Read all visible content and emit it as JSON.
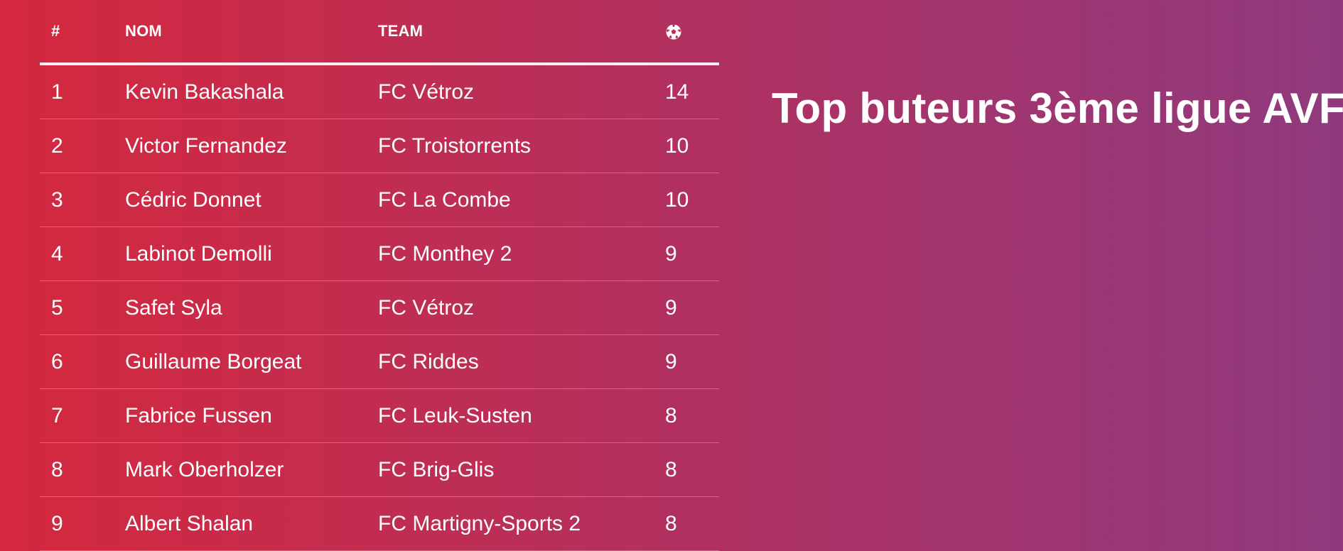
{
  "title": "Top buteurs 3ème ligue AVF",
  "table": {
    "headers": {
      "rank": "#",
      "name": "NOM",
      "team": "TEAM",
      "goals_icon": "soccer-ball-icon"
    },
    "rows": [
      {
        "rank": "1",
        "name": "Kevin Bakashala",
        "team": "FC Vétroz",
        "goals": "14"
      },
      {
        "rank": "2",
        "name": "Victor Fernandez",
        "team": "FC Troistorrents",
        "goals": "10"
      },
      {
        "rank": "3",
        "name": "Cédric Donnet",
        "team": "FC La Combe",
        "goals": "10"
      },
      {
        "rank": "4",
        "name": "Labinot Demolli",
        "team": "FC Monthey 2",
        "goals": "9"
      },
      {
        "rank": "5",
        "name": "Safet Syla",
        "team": "FC Vétroz",
        "goals": "9"
      },
      {
        "rank": "6",
        "name": "Guillaume Borgeat",
        "team": "FC Riddes",
        "goals": "9"
      },
      {
        "rank": "7",
        "name": "Fabrice Fussen",
        "team": "FC Leuk-Susten",
        "goals": "8"
      },
      {
        "rank": "8",
        "name": "Mark Oberholzer",
        "team": "FC Brig-Glis",
        "goals": "8"
      },
      {
        "rank": "9",
        "name": "Albert Shalan",
        "team": "FC Martigny-Sports 2",
        "goals": "8"
      }
    ]
  },
  "colors": {
    "gradient_start": "#d4283d",
    "gradient_end": "#903a7e",
    "text": "#ffffff"
  }
}
